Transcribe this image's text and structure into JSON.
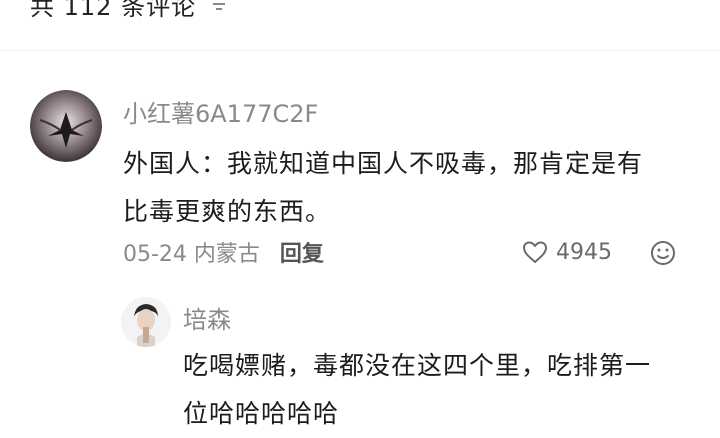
{
  "header": {
    "title": "共 112 条评论",
    "sort_icon": "sort-filter-icon"
  },
  "comment": {
    "username": "小红薯6A177C2F",
    "text_line1": "外国人：我就知道中国人不吸毒，那肯定是有",
    "text_line2": "比毒更爽的东西。",
    "date_location": "05-24 内蒙古",
    "reply_label": "回复",
    "like_count": "4945",
    "like_icon": "heart-icon",
    "emoji_icon": "emoji-smile-icon"
  },
  "reply": {
    "username": "培森",
    "text_line1": "吃喝嫖赌，毒都没在这四个里，吃排第一",
    "text_line2": "位哈哈哈哈哈"
  }
}
